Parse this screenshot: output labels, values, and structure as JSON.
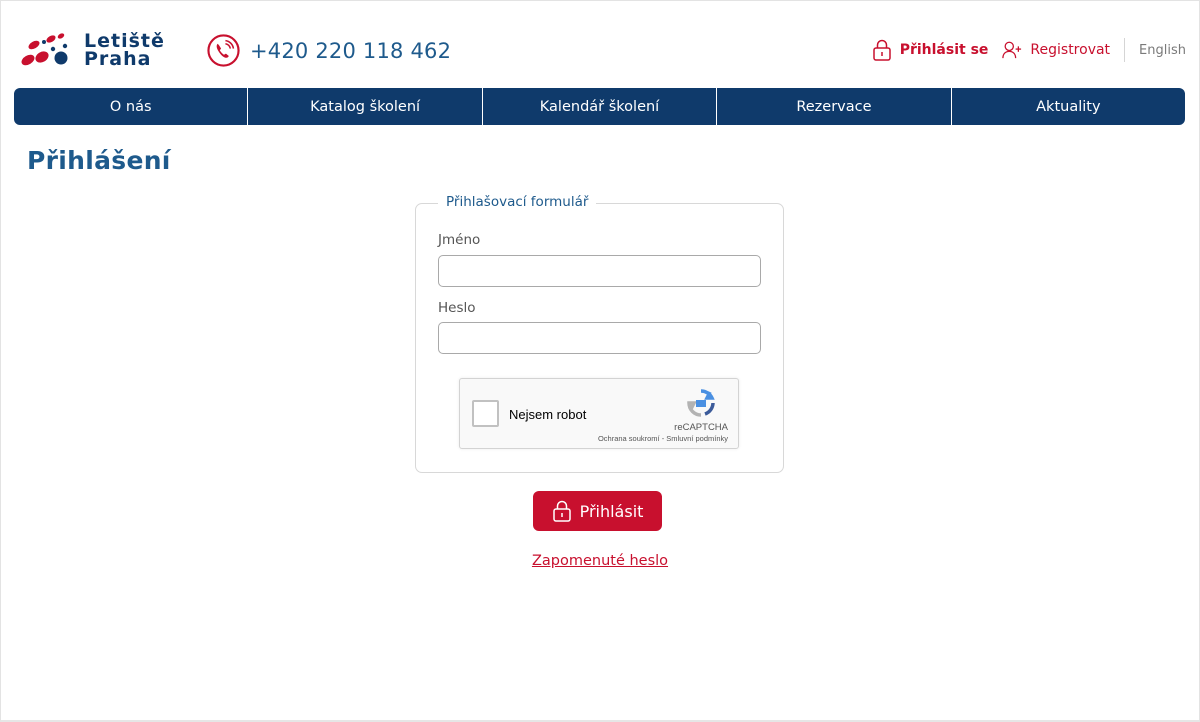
{
  "header": {
    "logo_line1": "Letiště",
    "logo_line2": "Praha",
    "phone": "+420 220 118 462",
    "login_label": "Přihlásit se",
    "register_label": "Registrovat",
    "language_label": "English"
  },
  "nav": {
    "items": [
      "O nás",
      "Katalog školení",
      "Kalendář školení",
      "Rezervace",
      "Aktuality"
    ]
  },
  "page": {
    "title": "Přihlášení"
  },
  "form": {
    "legend": "Přihlašovací formulář",
    "name_label": "Jméno",
    "name_value": "",
    "password_label": "Heslo",
    "password_value": "",
    "captcha": {
      "label": "Nejsem robot",
      "brand": "reCAPTCHA",
      "terms": "Ochrana soukromí - Smluvní podmínky"
    },
    "submit_label": "Přihlásit",
    "forgot_label": "Zapomenuté heslo"
  },
  "colors": {
    "brand_blue": "#0f3a6b",
    "accent_red": "#c8102e",
    "text_blue": "#1e5a8c"
  },
  "icons": {
    "phone": "phone-icon",
    "lock": "lock-icon",
    "user_add": "user-add-icon",
    "recaptcha": "recaptcha-icon"
  }
}
